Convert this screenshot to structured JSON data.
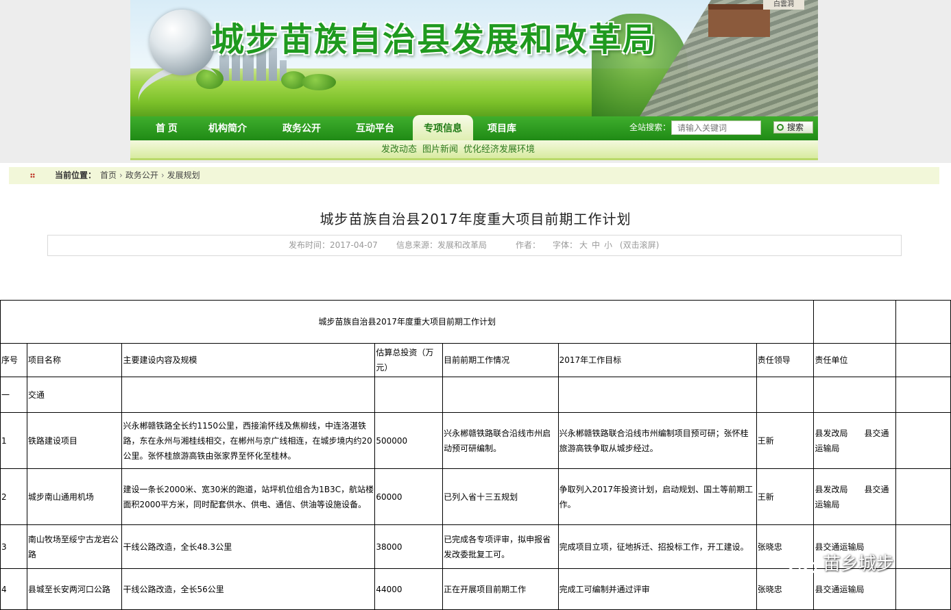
{
  "site": {
    "banner_title": "城步苗族自治县发展和改革局",
    "banner_sign": "白雲洞"
  },
  "nav": {
    "items": [
      {
        "label": "首 页"
      },
      {
        "label": "机构简介"
      },
      {
        "label": "政务公开"
      },
      {
        "label": "互动平台"
      },
      {
        "label": "专项信息",
        "active": true
      },
      {
        "label": "项目库"
      }
    ],
    "search_label": "全站搜索：",
    "search_placeholder": "请输入关键词",
    "search_button": "搜索",
    "sub_items": [
      "发改动态",
      "图片新闻",
      "优化经济发展环境"
    ]
  },
  "breadcrumb": {
    "label": "当前位置：",
    "items": [
      "首页",
      "政务公开",
      "发展规划"
    ],
    "sep": "›"
  },
  "article": {
    "title": "城步苗族自治县2017年度重大项目前期工作计划",
    "publish": "发布时间：2017-04-07",
    "source": "信息来源：发展和改革局",
    "author": "作者：",
    "font_label": "字体：",
    "font_sizes": [
      "大",
      "中",
      "小"
    ],
    "scroll_hint": "(双击滚屏)"
  },
  "table": {
    "title": "城步苗族自治县2017年度重大项目前期工作计划",
    "headers": [
      "序号",
      "项目名称",
      "主要建设内容及规模",
      "估算总投资（万元）",
      "目前前期工作情况",
      "2017年工作目标",
      "责任领导",
      "责任单位"
    ],
    "section": {
      "no": "一",
      "name": "交通"
    },
    "rows": [
      {
        "no": "1",
        "name": "铁路建设项目",
        "content": "兴永郴赣铁路全长约1150公里，西接渝怀线及焦柳线，中连洛湛铁路，东在永州与湘桂线相交，在郴州与京广线相连，在城步境内约20公里。张怀桂旅游高铁由张家界至怀化至桂林。",
        "invest": "500000",
        "status": "兴永郴赣铁路联合沿线市州启动预可研编制。",
        "goal": "兴永郴赣铁路联合沿线市州编制项目预可研；张怀桂旅游高铁争取从城步经过。",
        "leader": "王新",
        "unit": "县发改局　　县交通运输局"
      },
      {
        "no": "2",
        "name": "城步南山通用机场",
        "content": "建设一条长2000米、宽30米的跑道，站坪机位组合为1B3C，航站楼面积2000平方米，同时配套供水、供电、通信、供油等设施设备。",
        "invest": "60000",
        "status": "已列入省十三五规划",
        "goal": "争取列入2017年投资计划，启动规划、国土等前期工作。",
        "leader": "王新",
        "unit": "县发改局　　县交通运输局"
      },
      {
        "no": "3",
        "name": "南山牧场至绥宁古龙岩公路",
        "content": "干线公路改造，全长48.3公里",
        "invest": "38000",
        "status": "已完成各专项评审，拟申报省发改委批复工可。",
        "goal": "完成项目立项，征地拆迁、招投标工作，开工建设。",
        "leader": "张晓忠",
        "unit": "县交通运输局"
      },
      {
        "no": "4",
        "name": "县城至长安两河口公路",
        "content": "干线公路改造，全长56公里",
        "invest": "44000",
        "status": "正在开展项目前期工作",
        "goal": "完成工可编制并通过评审",
        "leader": "张晓忠",
        "unit": "县交通运输局"
      }
    ]
  },
  "watermark": {
    "text": "苗乡城步"
  },
  "colors": {
    "nav_green": "#1f8a15",
    "title_green": "#1f9a1f",
    "crumb_bg": "#f2f7d9"
  }
}
